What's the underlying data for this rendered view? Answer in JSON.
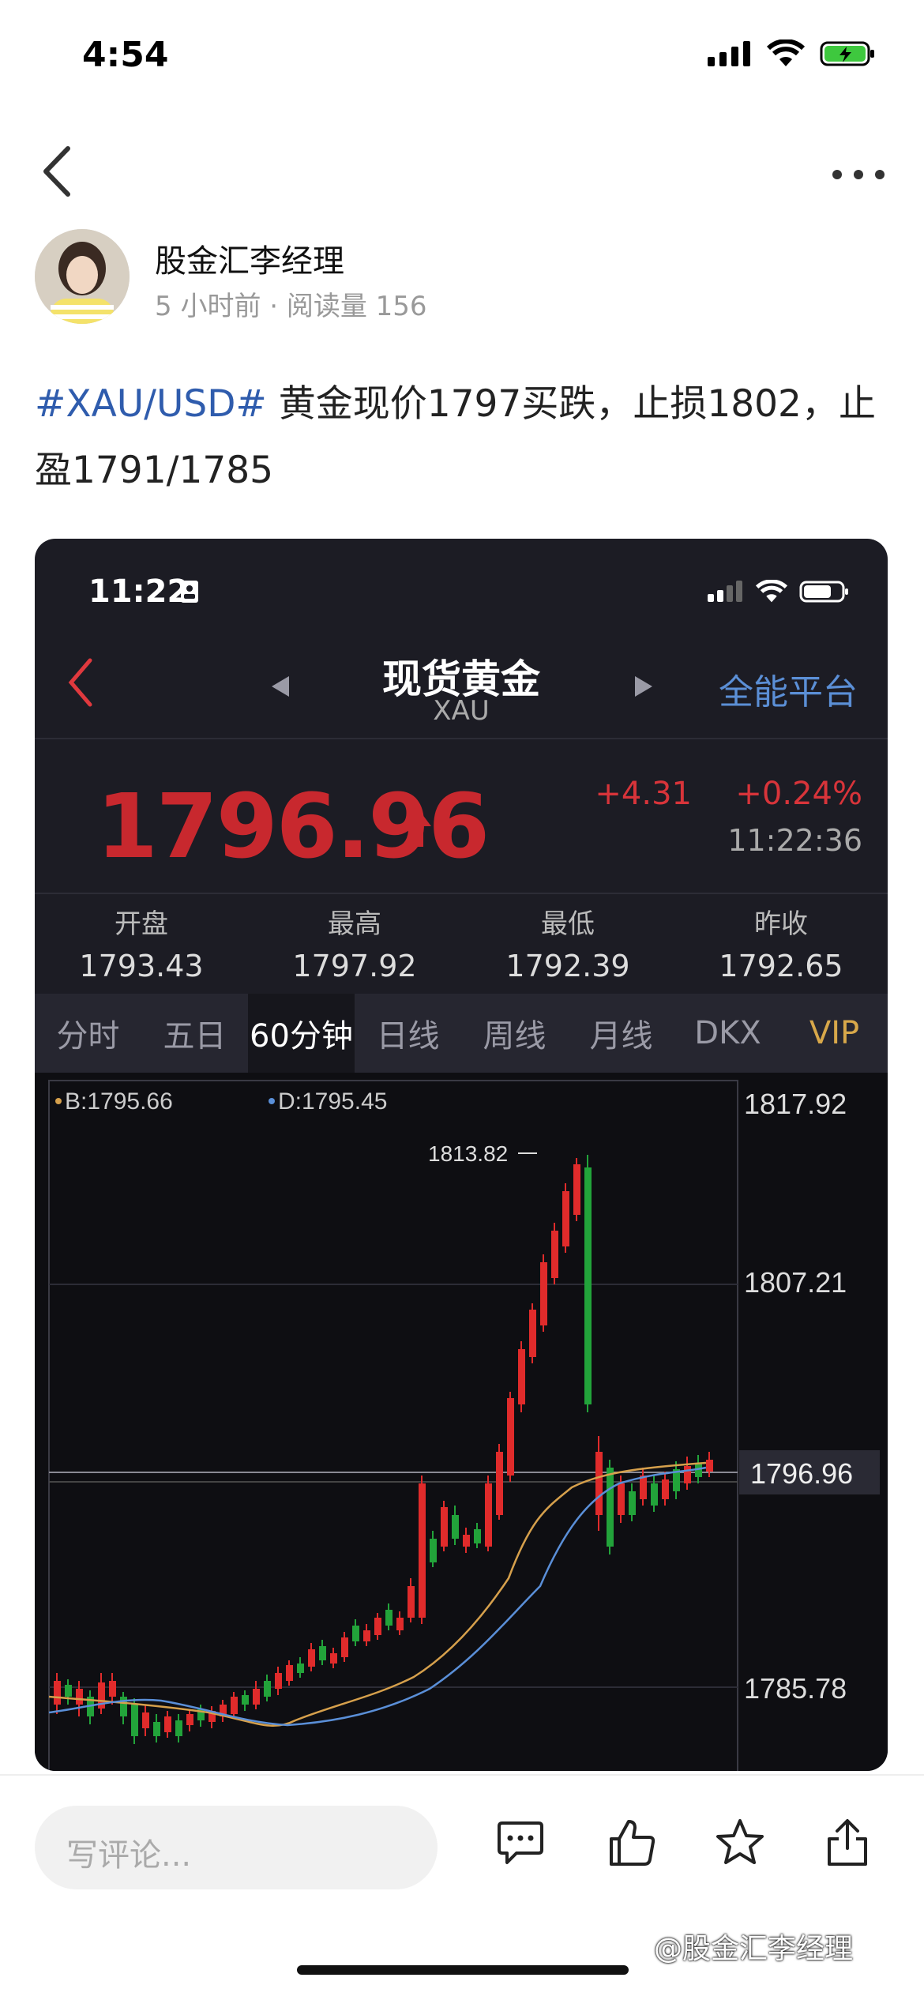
{
  "status_bar": {
    "time": "4:54"
  },
  "post_meta": {
    "author": "股金汇李经理",
    "meta": "5 小时前 · 阅读量 156"
  },
  "post": {
    "hashtag": "#XAU/USD#",
    "text": " 黄金现价1797买跌，止损1802，止盈1791/1785"
  },
  "card": {
    "time": "11:22",
    "title": "现货黄金",
    "subtitle": "XAU",
    "platform": "全能平台",
    "price": "1796.96",
    "change_abs": "+4.31",
    "change_pct": "+0.24%",
    "quote_time": "11:22:36",
    "stats": [
      {
        "label": "开盘",
        "value": "1793.43"
      },
      {
        "label": "最高",
        "value": "1797.92"
      },
      {
        "label": "最低",
        "value": "1792.39"
      },
      {
        "label": "昨收",
        "value": "1792.65"
      }
    ],
    "tabs": [
      "分时",
      "五日",
      "60分钟",
      "日线",
      "周线",
      "月线",
      "DKX",
      "VIP"
    ],
    "selected_tab": "60分钟",
    "indicator_b": "B:1795.66",
    "indicator_d": "D:1795.45",
    "y_labels": [
      "1817.92",
      "1807.21",
      "1796.96",
      "1785.78"
    ],
    "peak_label": "1813.82",
    "colors": {
      "up": "#e02b2b",
      "down": "#22a33a",
      "b_line": "#d6a04c",
      "d_line": "#5a8fd8"
    }
  },
  "bottom": {
    "comment_placeholder": "写评论...",
    "watermark": "@股金汇李经理"
  }
}
